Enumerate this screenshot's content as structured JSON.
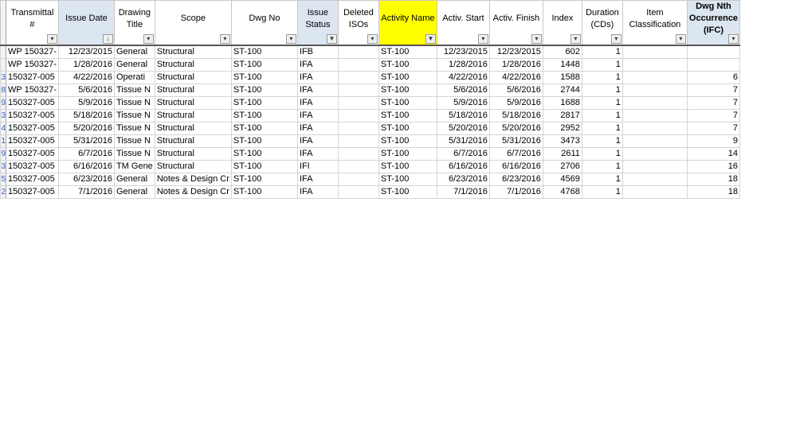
{
  "columns": [
    {
      "label": "Transmittal #",
      "filter": "▾",
      "style": "plain"
    },
    {
      "label": "Issue Date",
      "filter": "↓",
      "style": "blue"
    },
    {
      "label": "Drawing Title",
      "filter": "▾",
      "style": "plain"
    },
    {
      "label": "Scope",
      "filter": "▾",
      "style": "plain"
    },
    {
      "label": "Dwg No",
      "filter": "▾",
      "style": "plain"
    },
    {
      "label": "Issue Status",
      "filter": "▼",
      "style": "blue"
    },
    {
      "label": "Deleted ISOs",
      "filter": "▾",
      "style": "plain"
    },
    {
      "label": "Activity Name",
      "filter": "▼",
      "style": "yellow"
    },
    {
      "label": "Activ. Start",
      "filter": "▾",
      "style": "plain"
    },
    {
      "label": "Activ. Finish",
      "filter": "▾",
      "style": "plain"
    },
    {
      "label": "Index",
      "filter": "▾",
      "style": "plain"
    },
    {
      "label": "Duration (CDs)",
      "filter": "▾",
      "style": "plain"
    },
    {
      "label": "Item Classification",
      "filter": "▾",
      "style": "plain"
    },
    {
      "label": "Dwg Nth Occurrence (IFC)",
      "filter": "▾",
      "style": "blue-bold"
    }
  ],
  "rows": [
    {
      "rownum": "",
      "cells": [
        "WP 150327-",
        "12/23/2015",
        "General",
        "Structural",
        "ST-100",
        "IFB",
        "",
        "ST-100",
        "12/23/2015",
        "12/23/2015",
        "602",
        "1",
        "",
        ""
      ]
    },
    {
      "rownum": "",
      "cells": [
        "WP 150327-",
        "1/28/2016",
        "General",
        "Structural",
        "ST-100",
        "IFA",
        "",
        "ST-100",
        "1/28/2016",
        "1/28/2016",
        "1448",
        "1",
        "",
        ""
      ]
    },
    {
      "rownum": "3",
      "cells": [
        "150327-005",
        "4/22/2016",
        "Operati",
        "Structural",
        "ST-100",
        "IFA",
        "",
        "ST-100",
        "4/22/2016",
        "4/22/2016",
        "1588",
        "1",
        "",
        "6"
      ]
    },
    {
      "rownum": "8",
      "cells": [
        "WP 150327-",
        "5/6/2016",
        "Tissue N",
        "Structural",
        "ST-100",
        "IFA",
        "",
        "ST-100",
        "5/6/2016",
        "5/6/2016",
        "2744",
        "1",
        "",
        "7"
      ]
    },
    {
      "rownum": "9",
      "cells": [
        "150327-005",
        "5/9/2016",
        "Tissue N",
        "Structural",
        "ST-100",
        "IFA",
        "",
        "ST-100",
        "5/9/2016",
        "5/9/2016",
        "1688",
        "1",
        "",
        "7"
      ]
    },
    {
      "rownum": "3",
      "cells": [
        "150327-005",
        "5/18/2016",
        "Tissue N",
        "Structural",
        "ST-100",
        "IFA",
        "",
        "ST-100",
        "5/18/2016",
        "5/18/2016",
        "2817",
        "1",
        "",
        "7"
      ]
    },
    {
      "rownum": "4",
      "cells": [
        "150327-005",
        "5/20/2016",
        "Tissue N",
        "Structural",
        "ST-100",
        "IFA",
        "",
        "ST-100",
        "5/20/2016",
        "5/20/2016",
        "2952",
        "1",
        "",
        "7"
      ]
    },
    {
      "rownum": "1",
      "cells": [
        "150327-005",
        "5/31/2016",
        "Tissue N",
        "Structural",
        "ST-100",
        "IFA",
        "",
        "ST-100",
        "5/31/2016",
        "5/31/2016",
        "3473",
        "1",
        "",
        "9"
      ]
    },
    {
      "rownum": "9",
      "cells": [
        "150327-005",
        "6/7/2016",
        "Tissue N",
        "Structural",
        "ST-100",
        "IFA",
        "",
        "ST-100",
        "6/7/2016",
        "6/7/2016",
        "2611",
        "1",
        "",
        "14"
      ]
    },
    {
      "rownum": "3",
      "cells": [
        "150327-005",
        "6/16/2016",
        "TM Gene",
        "Structural",
        "ST-100",
        "IFI",
        "",
        "ST-100",
        "6/16/2016",
        "6/16/2016",
        "2706",
        "1",
        "",
        "16"
      ]
    },
    {
      "rownum": "5",
      "cells": [
        "150327-005",
        "6/23/2016",
        "General",
        "Notes & Design Cr",
        "ST-100",
        "IFA",
        "",
        "ST-100",
        "6/23/2016",
        "6/23/2016",
        "4569",
        "1",
        "",
        "18"
      ]
    },
    {
      "rownum": "2",
      "cells": [
        "150327-005",
        "7/1/2016",
        "General",
        "Notes & Design Cr",
        "ST-100",
        "IFA",
        "",
        "ST-100",
        "7/1/2016",
        "7/1/2016",
        "4768",
        "1",
        "",
        "18"
      ]
    }
  ]
}
